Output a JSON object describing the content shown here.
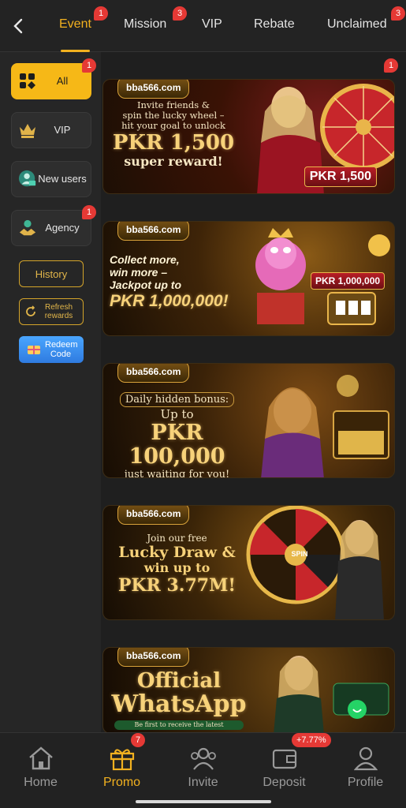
{
  "colors": {
    "accent": "#f2b11f",
    "badge": "#e53935",
    "background": "#1f1f1f"
  },
  "topnav": {
    "back_icon": "chevron-left-icon",
    "tabs": [
      {
        "label": "Event",
        "badge": "1",
        "active": true
      },
      {
        "label": "Mission",
        "badge": "3"
      },
      {
        "label": "VIP"
      },
      {
        "label": "Rebate"
      },
      {
        "label": "Unclaimed",
        "badge": "3"
      }
    ]
  },
  "sidebar": {
    "items": [
      {
        "label": "All",
        "icon": "grid-icon",
        "badge": "1",
        "active": true
      },
      {
        "label": "VIP",
        "icon": "crown-icon"
      },
      {
        "label": "New users",
        "icon": "new-user-icon"
      },
      {
        "label": "Agency",
        "icon": "agency-icon",
        "badge": "1"
      }
    ],
    "history_label": "History",
    "refresh_label": "Refresh rewards",
    "redeem_label": "Redeem Code"
  },
  "banners": [
    {
      "logo": "bba566.com",
      "badge": "1",
      "line1": "Invite friends &",
      "line2": "spin the lucky wheel –",
      "line3": "hit your goal to unlock",
      "amount": "PKR 1,500",
      "line4": "super reward!",
      "tag": "PKR 1,500"
    },
    {
      "logo": "bba566.com",
      "line1": "Collect more,",
      "line2": "win more –",
      "line3": "Jackpot up to",
      "amount": "PKR 1,000,000!",
      "tag": "PKR 1,000,000"
    },
    {
      "logo": "bba566.com",
      "line1": "Daily hidden bonus:",
      "line2": "Up to",
      "amount": "PKR 100,000",
      "line3": "just waiting for you!"
    },
    {
      "logo": "bba566.com",
      "line1": "Join our free",
      "line2": "Lucky Draw &",
      "line3": "win up to",
      "amount": "PKR 3.77M!",
      "wheel_label": "SPIN"
    },
    {
      "logo": "bba566.com",
      "line1": "Official",
      "line2": "WhatsApp",
      "line3": "Be first to receive the latest"
    }
  ],
  "bottomnav": {
    "items": [
      {
        "label": "Home",
        "icon": "home-icon"
      },
      {
        "label": "Promo",
        "icon": "gift-icon",
        "badge": "7",
        "active": true
      },
      {
        "label": "Invite",
        "icon": "invite-icon"
      },
      {
        "label": "Deposit",
        "icon": "wallet-icon",
        "badge": "+7.77%"
      },
      {
        "label": "Profile",
        "icon": "profile-icon"
      }
    ]
  }
}
